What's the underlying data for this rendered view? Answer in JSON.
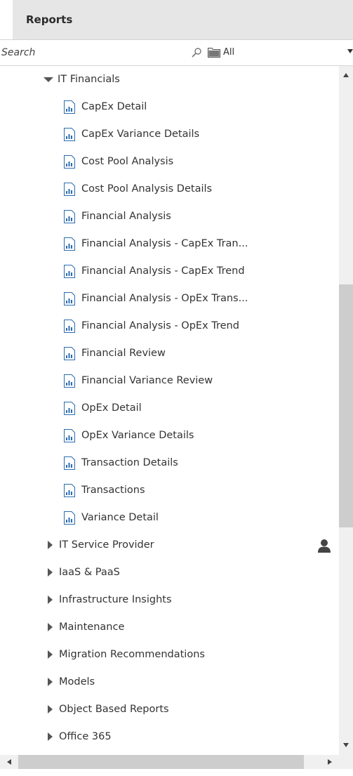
{
  "panel": {
    "title": "Reports"
  },
  "search": {
    "placeholder": "Search"
  },
  "filter": {
    "selected": "All"
  },
  "tree": {
    "expanded_folder": "IT Financials",
    "reports": [
      "CapEx Detail",
      "CapEx Variance Details",
      "Cost Pool Analysis",
      "Cost Pool Analysis Details",
      "Financial Analysis",
      "Financial Analysis - CapEx Tran...",
      "Financial Analysis - CapEx Trend",
      "Financial Analysis - OpEx Trans...",
      "Financial Analysis - OpEx Trend",
      "Financial Review",
      "Financial Variance Review",
      "OpEx Detail",
      "OpEx Variance Details",
      "Transaction Details",
      "Transactions",
      "Variance Detail"
    ],
    "folders": [
      "IT Service Provider",
      "IaaS & PaaS",
      "Infrastructure Insights",
      "Maintenance",
      "Migration Recommendations",
      "Models",
      "Object Based Reports",
      "Office 365"
    ]
  },
  "icons": {
    "search": "search-icon",
    "folder": "folder-icon",
    "report": "report-icon",
    "user": "user-icon"
  },
  "colors": {
    "header_bg": "#e6e6e6",
    "report_icon": "#2b6cb0",
    "scroll_thumb": "#cdcdcd"
  }
}
